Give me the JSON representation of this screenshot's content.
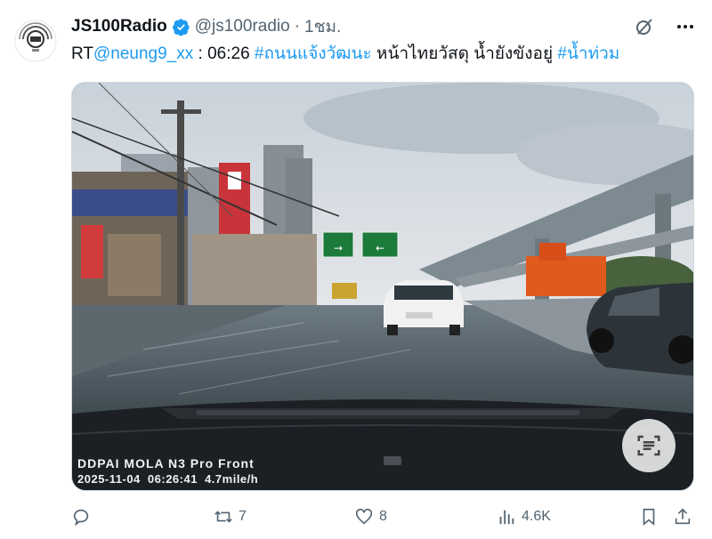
{
  "account": {
    "display_name": "JS100Radio",
    "handle": "@js100radio",
    "separator": "·",
    "time_ago": "1ชม.",
    "verified": true,
    "avatar_icon": "js100-logo-icon"
  },
  "tweet": {
    "rt_prefix": "RT",
    "mention": "@neung9_xx",
    "time_text": " : 06:26 ",
    "hashtag_1": "#ถนนแจ้งวัฒนะ",
    "body": " หน้าไทยวัสดุ น้ำยังขังอยู่ ",
    "hashtag_2": "#น้ำท่วม"
  },
  "media": {
    "camera_brand": "DDPAI MOLA N3 Pro Front",
    "date": "2025-11-04",
    "clock": "06:26:41",
    "speed": "4.7mile/h",
    "road_signs": [
      "→",
      "←"
    ],
    "scan_icon": "text-scan-icon"
  },
  "actions": {
    "reply_count": "",
    "retweet_count": "7",
    "like_count": "8",
    "views_count": "4.6K"
  },
  "colors": {
    "link": "#1d9bf0",
    "muted": "#536471",
    "verified": "#1d9bf0"
  }
}
